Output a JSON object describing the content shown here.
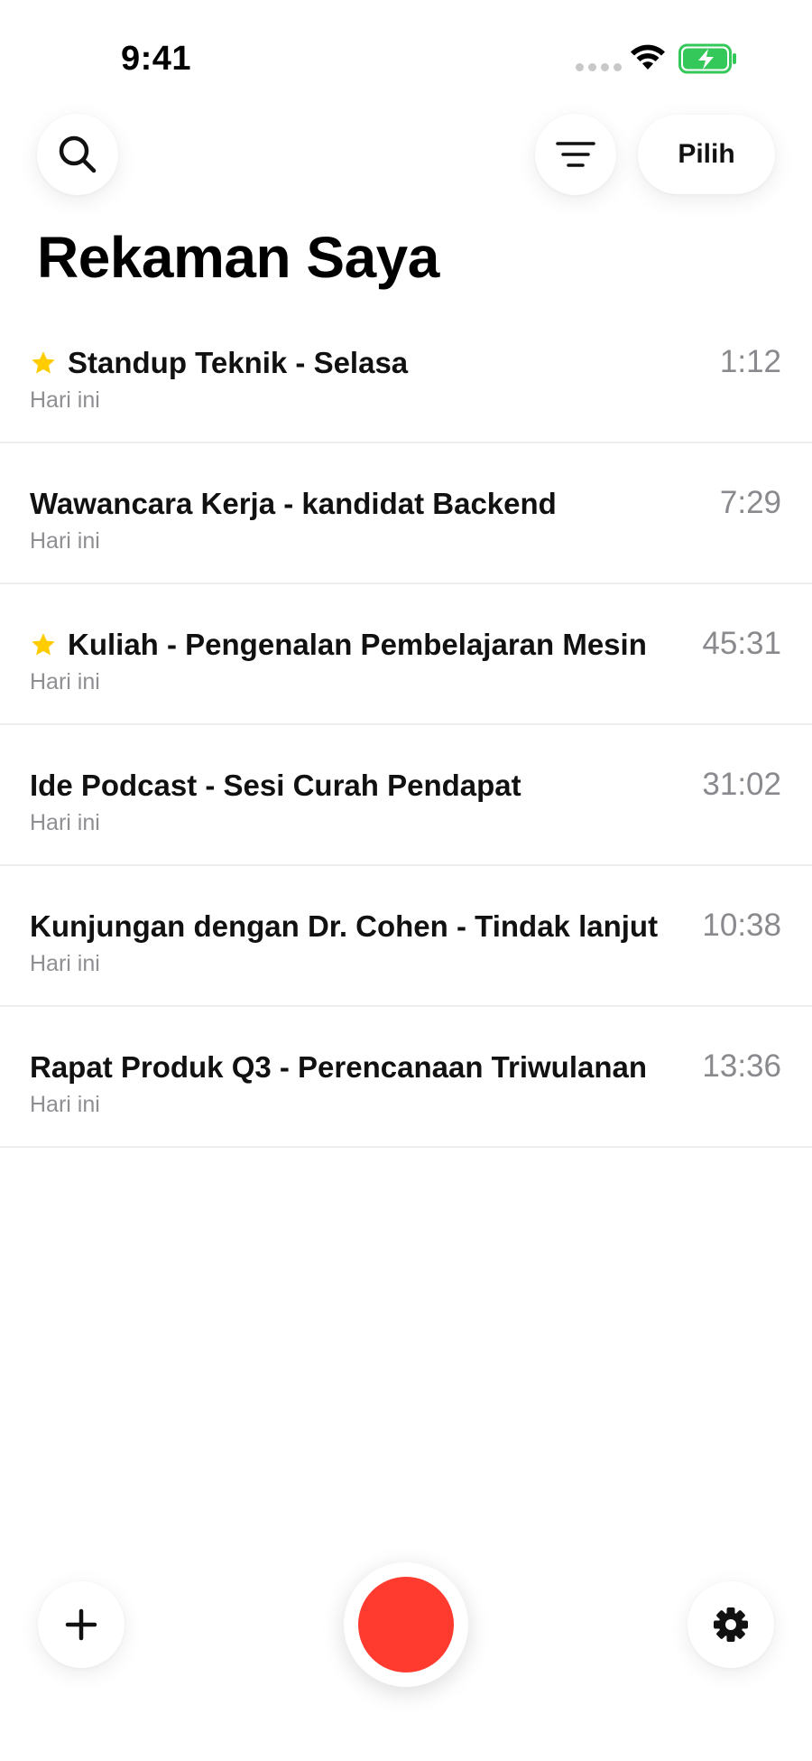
{
  "status_bar": {
    "time": "9:41"
  },
  "header": {
    "search_icon": "search-icon",
    "filter_icon": "filter-icon",
    "select_label": "Pilih",
    "title": "Rekaman Saya"
  },
  "recordings": [
    {
      "title": "Standup Teknik - Selasa",
      "date": "Hari ini",
      "duration": "1:12",
      "starred": true
    },
    {
      "title": "Wawancara Kerja - kandidat Backend",
      "date": "Hari ini",
      "duration": "7:29",
      "starred": false
    },
    {
      "title": "Kuliah - Pengenalan Pembelajaran Mesin",
      "date": "Hari ini",
      "duration": "45:31",
      "starred": true
    },
    {
      "title": "Ide Podcast - Sesi Curah Pendapat",
      "date": "Hari ini",
      "duration": "31:02",
      "starred": false
    },
    {
      "title": "Kunjungan dengan Dr. Cohen - Tindak lanjut",
      "date": "Hari ini",
      "duration": "10:38",
      "starred": false
    },
    {
      "title": "Rapat Produk Q3 - Perencanaan Triwulanan",
      "date": "Hari ini",
      "duration": "13:36",
      "starred": false
    }
  ],
  "bottom_bar": {
    "add_icon": "plus-icon",
    "record_icon": "record-icon",
    "settings_icon": "gear-icon"
  },
  "colors": {
    "record": "#ff3b30",
    "star": "#ffcc00",
    "battery": "#34c759",
    "secondary_text": "#8e8e93"
  }
}
